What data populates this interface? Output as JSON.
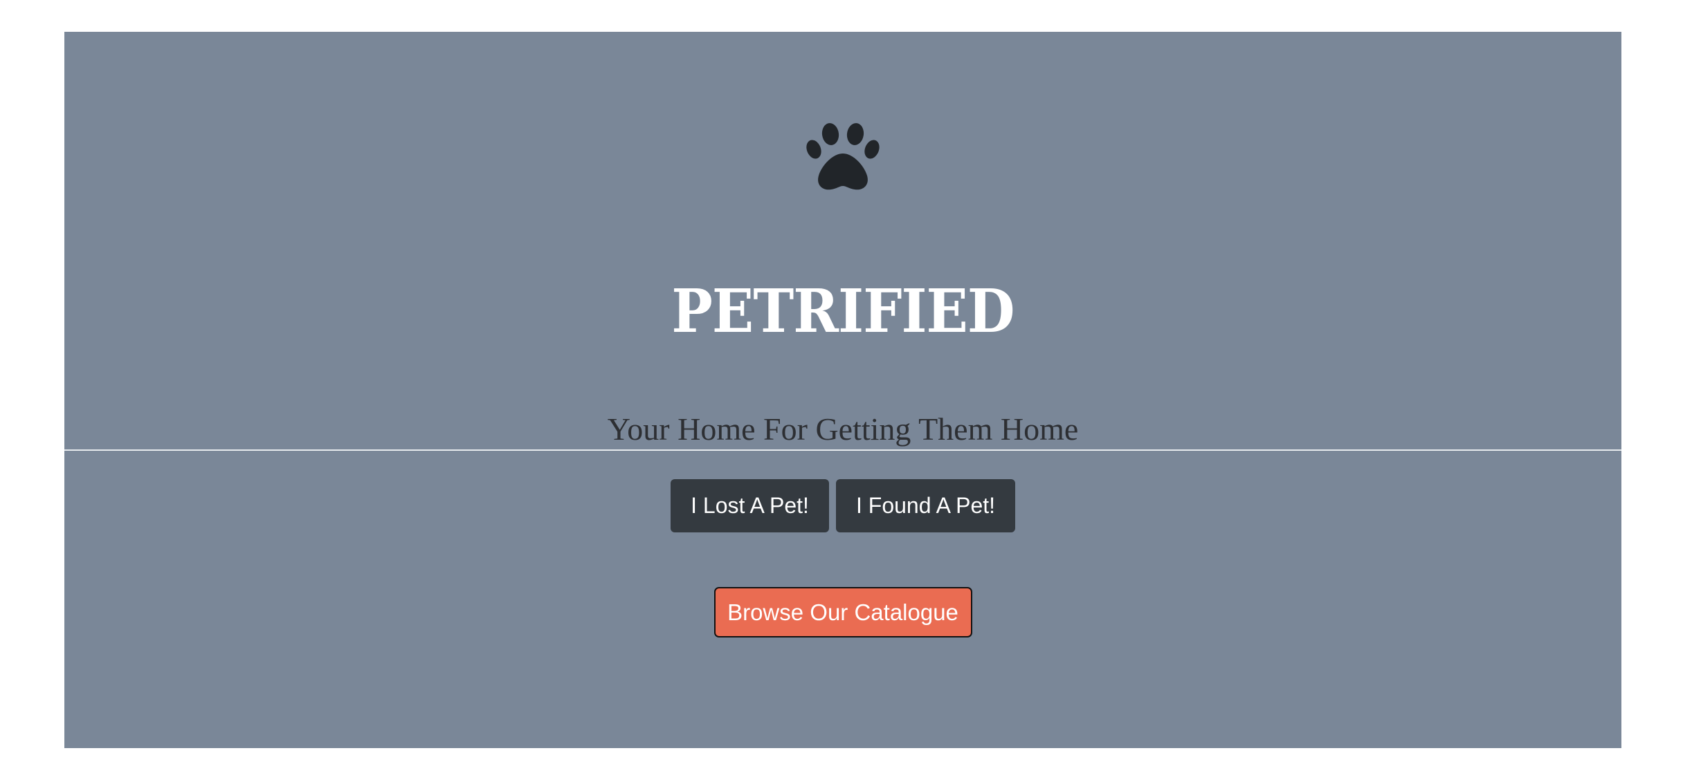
{
  "hero": {
    "logo_icon": "paw-icon",
    "logo_color": "#212529",
    "background_color": "#7a8798",
    "title": "PETRIFIED",
    "tagline": "Your Home For Getting Them Home"
  },
  "actions": {
    "lost_label": "I Lost A Pet!",
    "found_label": "I Found A Pet!",
    "browse_label": "Browse Our Catalogue",
    "button_dark_color": "#343a40",
    "button_accent_color": "#ea6c52"
  }
}
